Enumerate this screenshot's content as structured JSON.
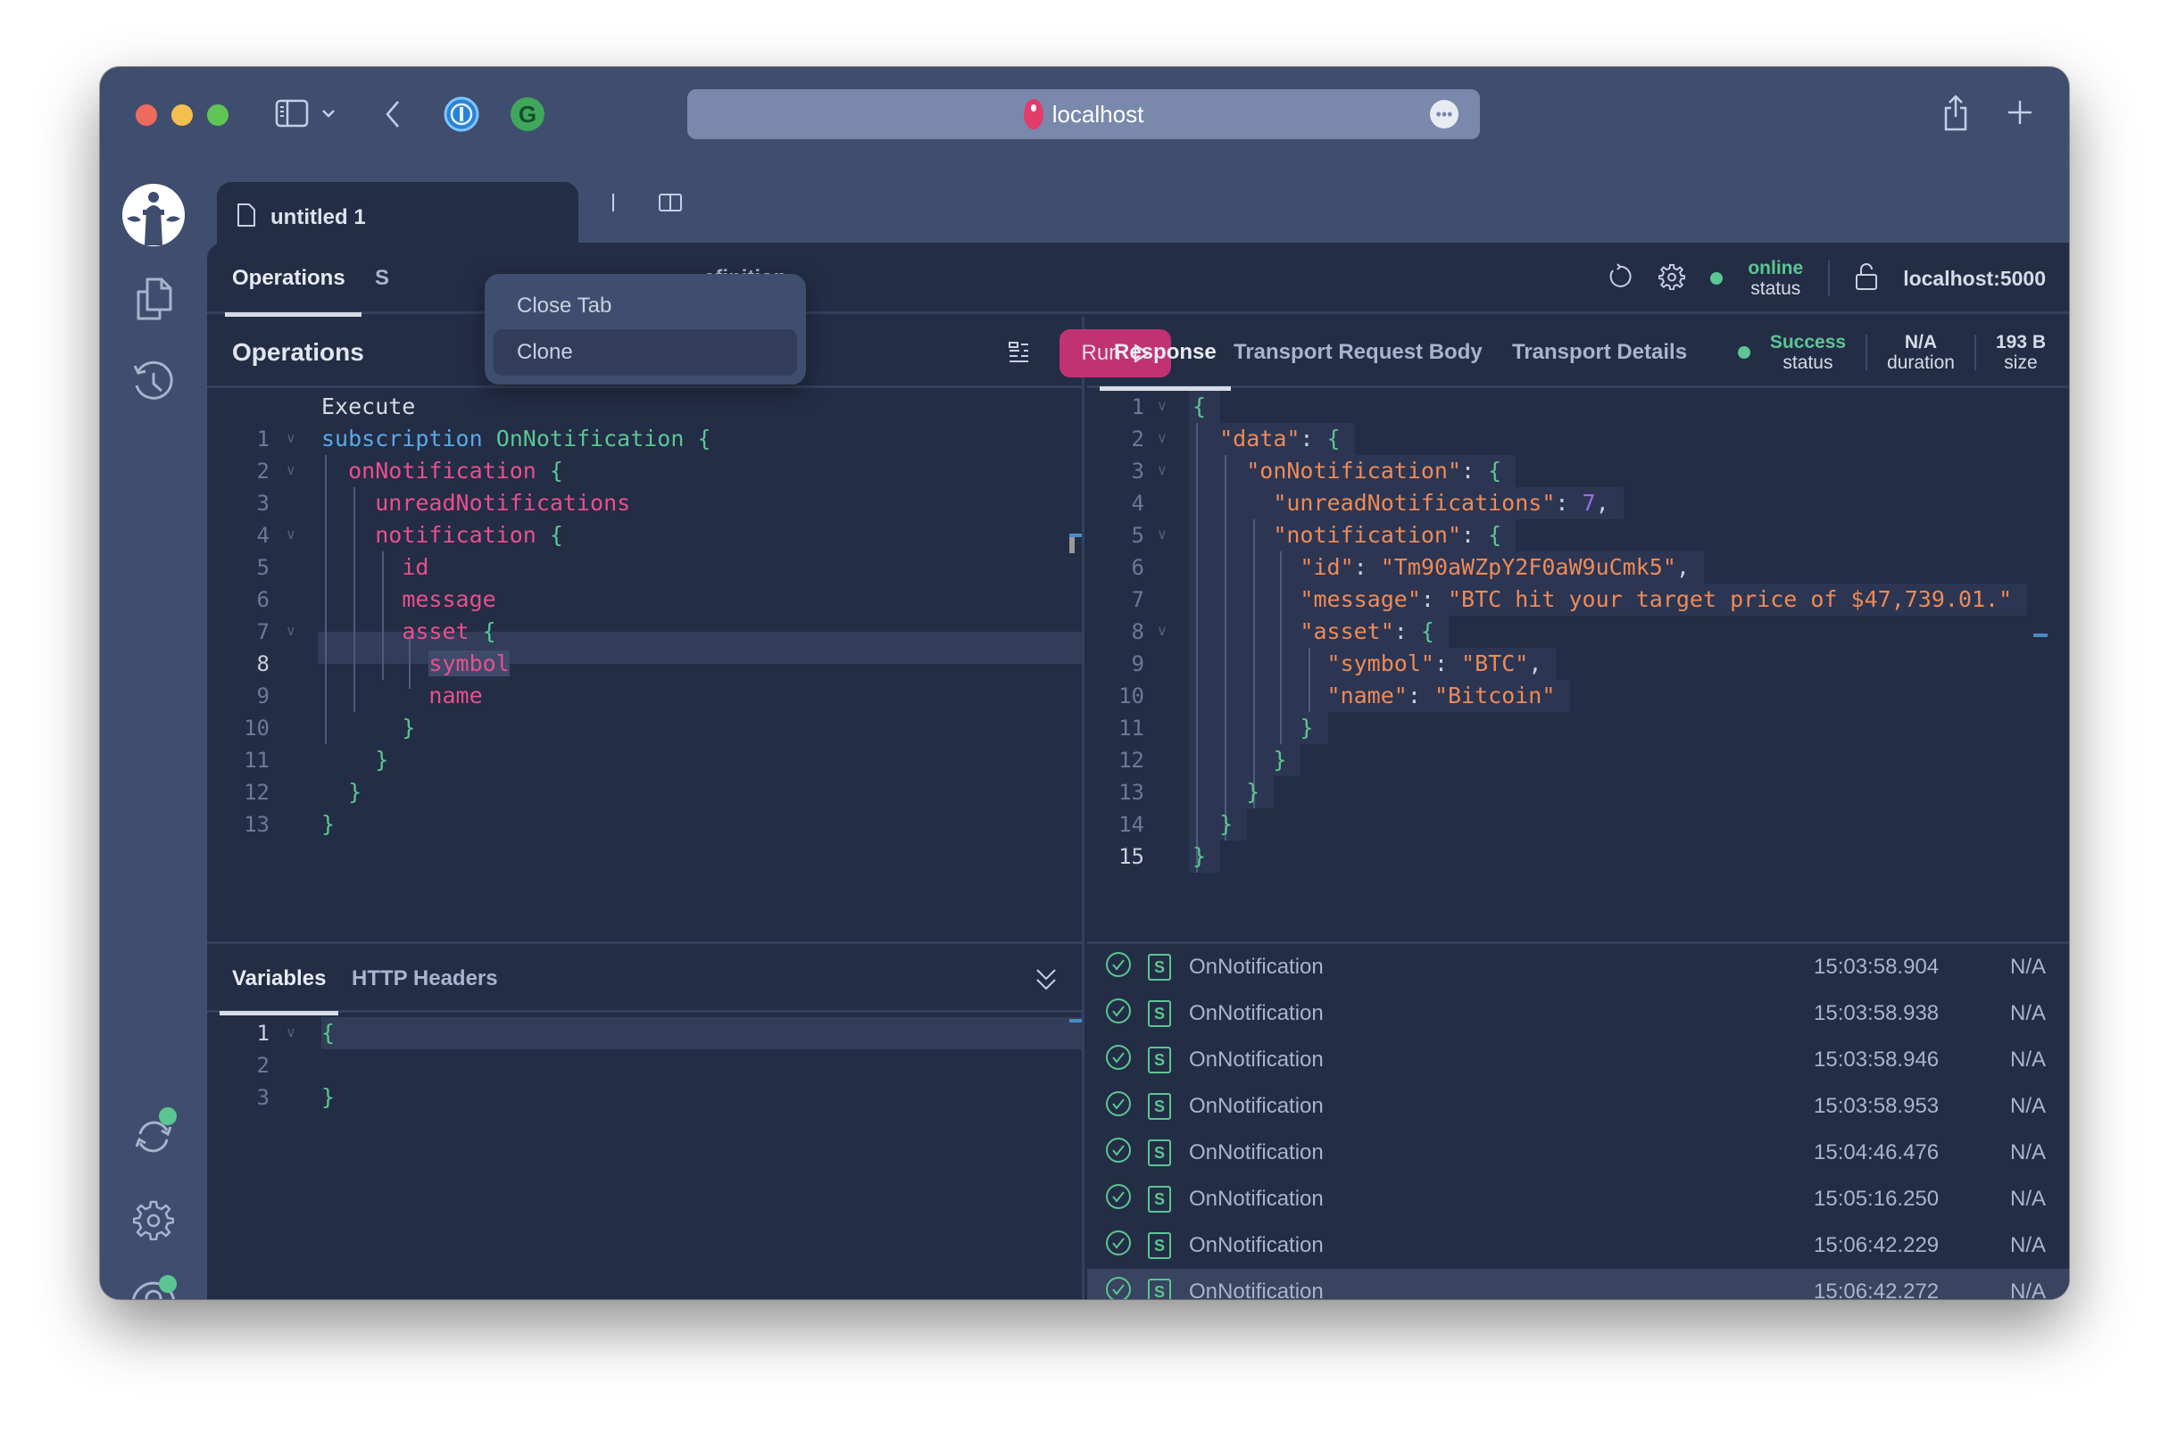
{
  "browser": {
    "url": "localhost",
    "more_icon": "ellipsis-icon"
  },
  "file_tab": {
    "title": "untitled 1"
  },
  "context_menu": {
    "items": [
      "Close Tab",
      "Clone"
    ],
    "highlighted": "Clone"
  },
  "subtabs": {
    "operations": "Operations",
    "schema_fragment": "S",
    "definition_fragment": "efinition"
  },
  "connection": {
    "status_value": "online",
    "status_label": "status",
    "endpoint": "localhost:5000"
  },
  "operations": {
    "title": "Operations",
    "run_label": "Run",
    "execute_label": "Execute",
    "lines": [
      {
        "n": "1",
        "tokens": [
          {
            "c": "kw",
            "t": "subscription"
          },
          {
            "c": "pun",
            "t": " "
          },
          {
            "c": "nm",
            "t": "OnNotification"
          },
          {
            "c": "pun",
            "t": " "
          },
          {
            "c": "br",
            "t": "{"
          }
        ]
      },
      {
        "n": "2",
        "tokens": [
          {
            "c": "pun",
            "t": "  "
          },
          {
            "c": "fld",
            "t": "onNotification"
          },
          {
            "c": "pun",
            "t": " "
          },
          {
            "c": "br",
            "t": "{"
          }
        ]
      },
      {
        "n": "3",
        "tokens": [
          {
            "c": "pun",
            "t": "    "
          },
          {
            "c": "fld",
            "t": "unreadNotifications"
          }
        ]
      },
      {
        "n": "4",
        "tokens": [
          {
            "c": "pun",
            "t": "    "
          },
          {
            "c": "fld",
            "t": "notification"
          },
          {
            "c": "pun",
            "t": " "
          },
          {
            "c": "br",
            "t": "{"
          }
        ]
      },
      {
        "n": "5",
        "tokens": [
          {
            "c": "pun",
            "t": "      "
          },
          {
            "c": "fld",
            "t": "id"
          }
        ]
      },
      {
        "n": "6",
        "tokens": [
          {
            "c": "pun",
            "t": "      "
          },
          {
            "c": "fld",
            "t": "message"
          }
        ]
      },
      {
        "n": "7",
        "tokens": [
          {
            "c": "pun",
            "t": "      "
          },
          {
            "c": "fld",
            "t": "asset"
          },
          {
            "c": "pun",
            "t": " "
          },
          {
            "c": "br",
            "t": "{"
          }
        ]
      },
      {
        "n": "8",
        "tokens": [
          {
            "c": "pun",
            "t": "        "
          },
          {
            "c": "fld sel",
            "t": "symbol"
          }
        ]
      },
      {
        "n": "9",
        "tokens": [
          {
            "c": "pun",
            "t": "        "
          },
          {
            "c": "fld",
            "t": "name"
          }
        ]
      },
      {
        "n": "10",
        "tokens": [
          {
            "c": "pun",
            "t": "      "
          },
          {
            "c": "br",
            "t": "}"
          }
        ]
      },
      {
        "n": "11",
        "tokens": [
          {
            "c": "pun",
            "t": "    "
          },
          {
            "c": "br",
            "t": "}"
          }
        ]
      },
      {
        "n": "12",
        "tokens": [
          {
            "c": "pun",
            "t": "  "
          },
          {
            "c": "br",
            "t": "}"
          }
        ]
      },
      {
        "n": "13",
        "tokens": [
          {
            "c": "br",
            "t": "}"
          }
        ]
      }
    ]
  },
  "variables": {
    "tabs": [
      "Variables",
      "HTTP Headers"
    ],
    "lines": [
      {
        "n": "1",
        "tokens": [
          {
            "c": "br",
            "t": "{"
          }
        ]
      },
      {
        "n": "2",
        "tokens": []
      },
      {
        "n": "3",
        "tokens": [
          {
            "c": "br",
            "t": "}"
          }
        ]
      }
    ]
  },
  "response": {
    "tabs": [
      "Response",
      "Transport Request Body",
      "Transport Details"
    ],
    "status_value": "Success",
    "status_label": "status",
    "duration_value": "N/A",
    "duration_label": "duration",
    "size_value": "193 B",
    "size_label": "size",
    "lines": [
      {
        "n": "1",
        "tokens": [
          {
            "c": "br",
            "t": "{"
          }
        ]
      },
      {
        "n": "2",
        "tokens": [
          {
            "c": "pun",
            "t": "  "
          },
          {
            "c": "str",
            "t": "\"data\""
          },
          {
            "c": "pun",
            "t": ": "
          },
          {
            "c": "br",
            "t": "{"
          }
        ]
      },
      {
        "n": "3",
        "tokens": [
          {
            "c": "pun",
            "t": "    "
          },
          {
            "c": "str",
            "t": "\"onNotification\""
          },
          {
            "c": "pun",
            "t": ": "
          },
          {
            "c": "br",
            "t": "{"
          }
        ]
      },
      {
        "n": "4",
        "tokens": [
          {
            "c": "pun",
            "t": "      "
          },
          {
            "c": "str",
            "t": "\"unreadNotifications\""
          },
          {
            "c": "pun",
            "t": ": "
          },
          {
            "c": "num",
            "t": "7"
          },
          {
            "c": "pun",
            "t": ","
          }
        ]
      },
      {
        "n": "5",
        "tokens": [
          {
            "c": "pun",
            "t": "      "
          },
          {
            "c": "str",
            "t": "\"notification\""
          },
          {
            "c": "pun",
            "t": ": "
          },
          {
            "c": "br",
            "t": "{"
          }
        ]
      },
      {
        "n": "6",
        "tokens": [
          {
            "c": "pun",
            "t": "        "
          },
          {
            "c": "str",
            "t": "\"id\""
          },
          {
            "c": "pun",
            "t": ": "
          },
          {
            "c": "str",
            "t": "\"Tm90aWZpY2F0aW9uCmk5\""
          },
          {
            "c": "pun",
            "t": ","
          }
        ]
      },
      {
        "n": "7",
        "tokens": [
          {
            "c": "pun",
            "t": "        "
          },
          {
            "c": "str",
            "t": "\"message\""
          },
          {
            "c": "pun",
            "t": ": "
          },
          {
            "c": "str",
            "t": "\"BTC hit your target price of $47,739.01.\""
          }
        ]
      },
      {
        "n": "8",
        "tokens": [
          {
            "c": "pun",
            "t": "        "
          },
          {
            "c": "str",
            "t": "\"asset\""
          },
          {
            "c": "pun",
            "t": ": "
          },
          {
            "c": "br",
            "t": "{"
          }
        ]
      },
      {
        "n": "9",
        "tokens": [
          {
            "c": "pun",
            "t": "          "
          },
          {
            "c": "str",
            "t": "\"symbol\""
          },
          {
            "c": "pun",
            "t": ": "
          },
          {
            "c": "str",
            "t": "\"BTC\""
          },
          {
            "c": "pun",
            "t": ","
          }
        ]
      },
      {
        "n": "10",
        "tokens": [
          {
            "c": "pun",
            "t": "          "
          },
          {
            "c": "str",
            "t": "\"name\""
          },
          {
            "c": "pun",
            "t": ": "
          },
          {
            "c": "str",
            "t": "\"Bitcoin\""
          }
        ]
      },
      {
        "n": "11",
        "tokens": [
          {
            "c": "pun",
            "t": "        "
          },
          {
            "c": "br",
            "t": "}"
          }
        ]
      },
      {
        "n": "12",
        "tokens": [
          {
            "c": "pun",
            "t": "      "
          },
          {
            "c": "br",
            "t": "}"
          }
        ]
      },
      {
        "n": "13",
        "tokens": [
          {
            "c": "pun",
            "t": "    "
          },
          {
            "c": "br",
            "t": "}"
          }
        ]
      },
      {
        "n": "14",
        "tokens": [
          {
            "c": "pun",
            "t": "  "
          },
          {
            "c": "br",
            "t": "}"
          }
        ]
      },
      {
        "n": "15",
        "tokens": [
          {
            "c": "br",
            "t": "}"
          }
        ]
      }
    ]
  },
  "history": [
    {
      "type": "S",
      "name": "OnNotification",
      "time": "15:03:58.904",
      "duration": "N/A"
    },
    {
      "type": "S",
      "name": "OnNotification",
      "time": "15:03:58.938",
      "duration": "N/A"
    },
    {
      "type": "S",
      "name": "OnNotification",
      "time": "15:03:58.946",
      "duration": "N/A"
    },
    {
      "type": "S",
      "name": "OnNotification",
      "time": "15:03:58.953",
      "duration": "N/A"
    },
    {
      "type": "S",
      "name": "OnNotification",
      "time": "15:04:46.476",
      "duration": "N/A"
    },
    {
      "type": "S",
      "name": "OnNotification",
      "time": "15:05:16.250",
      "duration": "N/A"
    },
    {
      "type": "S",
      "name": "OnNotification",
      "time": "15:06:42.229",
      "duration": "N/A"
    },
    {
      "type": "S",
      "name": "OnNotification",
      "time": "15:06:42.272",
      "duration": "N/A",
      "selected": true
    }
  ],
  "colors": {
    "accent_run": "#c13273",
    "success": "#5bc693",
    "field": "#e8508d",
    "string": "#ee8a58"
  }
}
